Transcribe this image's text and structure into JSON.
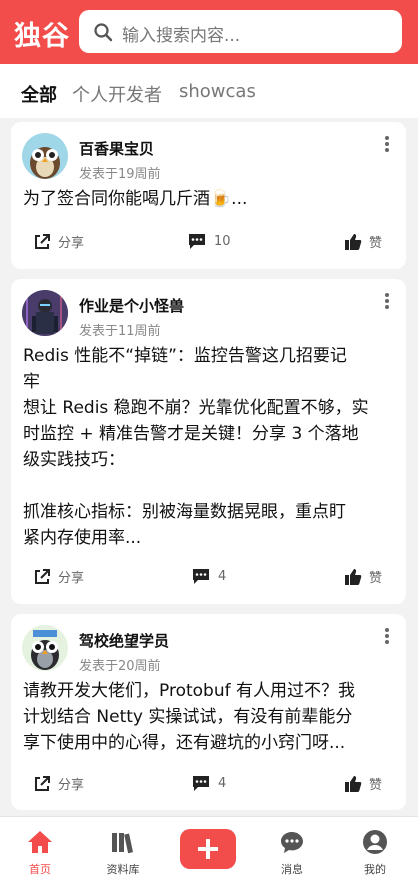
{
  "app": {
    "logo": "独谷"
  },
  "search": {
    "placeholder": "输入搜索内容..."
  },
  "tabs": [
    {
      "label": "全部",
      "active": true
    },
    {
      "label": "个人开发者",
      "active": false
    },
    {
      "label": "showcas",
      "active": false
    }
  ],
  "posts": [
    {
      "author": "百香果宝贝",
      "time": "发表于19周前",
      "content": "为了签合同你能喝几斤酒🍺...",
      "share": "分享",
      "comments": "10",
      "like": "赞"
    },
    {
      "author": "作业是个小怪兽",
      "time": "发表于11周前",
      "content": "Redis 性能不“掉链”：监控告警这几招要记\n牢\n想让 Redis 稳跑不崩？光靠优化配置不够，实\n时监控 + 精准告警才是关键！分享 3 个落地\n级实践技巧：\n\n抓准核心指标：别被海量数据晃眼，重点盯\n紧内存使用率...",
      "share": "分享",
      "comments": "4",
      "like": "赞"
    },
    {
      "author": "驾校绝望学员",
      "time": "发表于20周前",
      "content": "请教开发大佬们，Protobuf 有人用过不？我\n计划结合 Netty 实操试试，有没有前辈能分\n享下使用中的心得，还有避坑的小窍门呀...",
      "share": "分享",
      "comments": "4",
      "like": "赞"
    }
  ],
  "bottom_nav": [
    {
      "label": "首页",
      "icon": "home-icon",
      "active": true
    },
    {
      "label": "资料库",
      "icon": "library-icon",
      "active": false
    },
    {
      "label": "消息",
      "icon": "message-icon",
      "active": false
    },
    {
      "label": "我的",
      "icon": "profile-icon",
      "active": false
    }
  ],
  "colors": {
    "accent": "#f24d4a"
  }
}
